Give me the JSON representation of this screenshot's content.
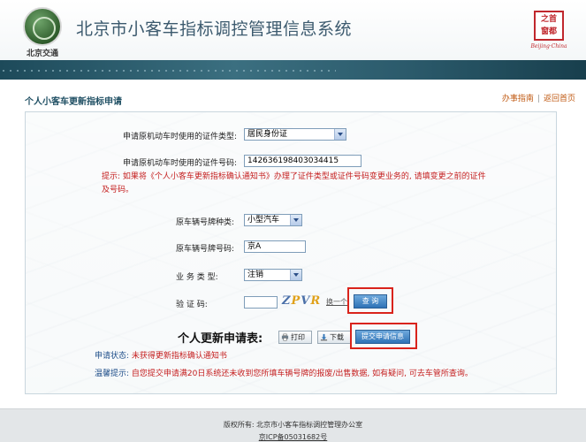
{
  "header": {
    "logo_text": "北京交通",
    "title": "北京市小客车指标调控管理信息系统",
    "seal_text": "之首\n窗都",
    "seal_sub": "Beijing·China"
  },
  "nav": {
    "page_heading": "个人小客车更新指标申请",
    "link_guide": "办事指南",
    "link_home": "返回首页",
    "separator": "|"
  },
  "form": {
    "id_type_label": "申请原机动车时使用的证件类型:",
    "id_type_value": "居民身份证",
    "id_number_label": "申请原机动车时使用的证件号码:",
    "id_number_value": "142636198403034415",
    "hint_text": "提示: 如果将《个人小客车更新指标确认通知书》办理了证件类型或证件号码变更业务的, 请填变更之前的证件及号码。",
    "plate_type_label": "原车辆号牌种类:",
    "plate_type_value": "小型汽车",
    "plate_number_label": "原车辆号牌号码:",
    "plate_number_value": "京A",
    "business_type_label": "业 务 类 型:",
    "business_type_value": "注销",
    "captcha_label": "验 证 码:",
    "captcha_value": "",
    "captcha_chars": [
      "Z",
      "P",
      "V",
      "R"
    ],
    "captcha_refresh": "换一个",
    "query_button": "查 询"
  },
  "update_section": {
    "title": "个人更新申请表:",
    "print_button": "打印",
    "download_button": "下载",
    "submit_button": "提交申请信息"
  },
  "status": {
    "status_label": "申请状态:",
    "status_value": "未获得更新指标确认通知书",
    "tip_label": "温馨提示:",
    "tip_value": "自您提交申请满20日系统还未收到您所填车辆号牌的报废/出售数据, 如有疑问, 可去车管所查询。"
  },
  "footer": {
    "copyright": "版权所有: 北京市小客车指标调控管理办公室",
    "icp": "京ICP备05031682号"
  },
  "colors": {
    "band": "#2b5a6b",
    "heading": "#1f4f63",
    "hint_red": "#c51f1f",
    "highlight_red": "#d9231b",
    "button_blue": "#2e72b6"
  }
}
